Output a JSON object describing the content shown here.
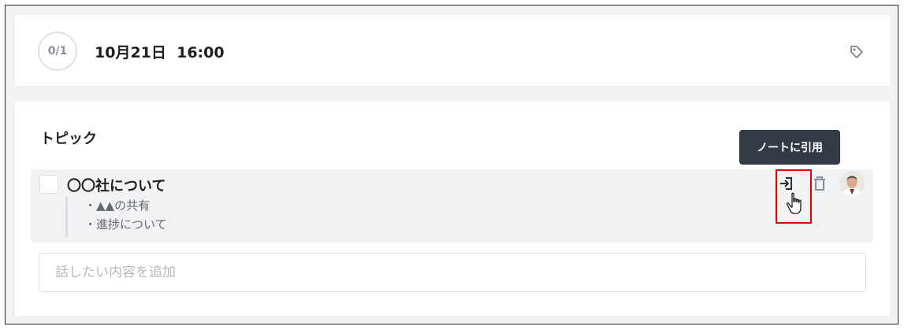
{
  "header": {
    "progress": "0/1",
    "datetime": "10月21日  16:00",
    "tag_icon": "tag-icon"
  },
  "topics_section": {
    "title": "トピック",
    "tooltip": "ノートに引用",
    "items": [
      {
        "title": "〇〇社について",
        "notes": [
          "・▲▲の共有",
          "・進捗について"
        ],
        "actions": [
          "quote-to-note-icon",
          "trash-icon"
        ],
        "avatar": "avatar"
      }
    ],
    "input_placeholder": "話したい内容を追加"
  },
  "colors": {
    "tooltip_bg": "#323a44",
    "highlight": "#e00000",
    "icon_gray": "#8a9099"
  }
}
